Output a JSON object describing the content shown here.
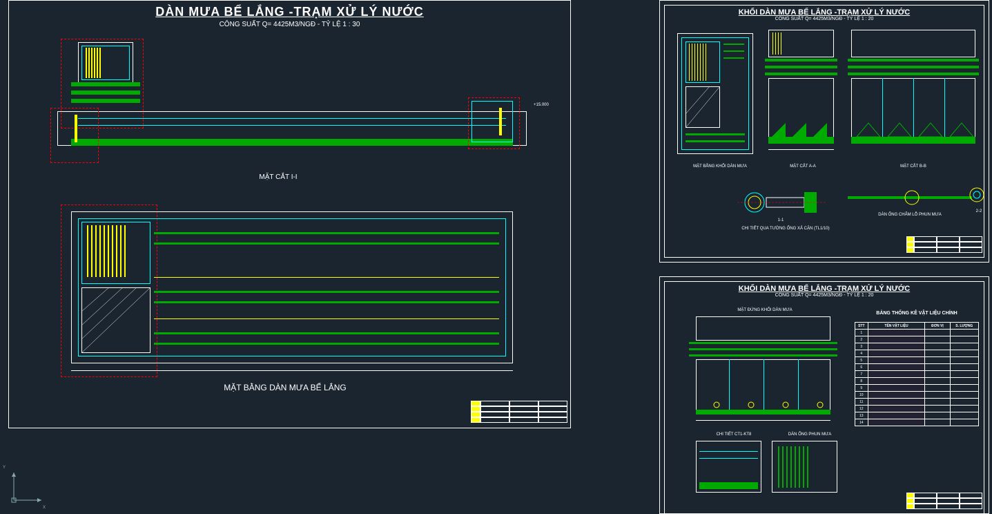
{
  "sheet1": {
    "title": "DÀN MƯA BỂ LẮNG -TRẠM XỬ LÝ NƯỚC",
    "subtitle": "CÔNG SUẤT Q= 4425M3/NGĐ - TỶ LỆ 1 : 30",
    "section_label": "MẶT CẮT I-I",
    "plan_label": "MẶT BẰNG DÀN MƯA BỂ LẮNG",
    "elevation_mark": "+15.000"
  },
  "sheet2": {
    "title": "KHỐI DÀN MƯA BỂ LẮNG -TRẠM XỬ LÝ NƯỚC",
    "subtitle": "CÔNG SUẤT Q= 4425M3/NGĐ - TỶ LỆ 1 : 20",
    "plan_label": "MẶT BẰNG KHỐI DÀN MƯA",
    "section_a": "MẶT CẮT A-A",
    "section_b": "MẶT CẮT B-B",
    "detail_pipe": "CHI TIẾT QUA TƯỜNG ỐNG XẢ CẶN (TL1/10)",
    "detail_11": "1-1",
    "detail_spray": "DÀN ỐNG CHẨM LỖ PHUN MƯA",
    "detail_22": "2-2"
  },
  "sheet3": {
    "title": "KHỐI DÀN MƯA BỂ LẮNG -TRẠM XỬ LÝ NƯỚC",
    "subtitle": "CÔNG SUẤT Q= 4425M3/NGĐ - TỶ LỆ 1 : 20",
    "elev_label": "MẶT ĐỨNG KHỐI DÀN MƯA",
    "detail_ct": "CHI TIẾT CT1-KT8",
    "detail_spray2": "DÀN ỐNG PHUN MƯA",
    "table_title": "BẢNG THỐNG KÊ VẬT LIỆU CHÍNH",
    "table_headers": {
      "c1": "STT",
      "c2": "TÊN VẬT LIỆU",
      "c3": "ĐƠN VỊ",
      "c4": "S. LƯỢNG"
    },
    "table_rows": [
      {
        "n": "1",
        "name": "",
        "unit": "",
        "qty": ""
      },
      {
        "n": "2",
        "name": "",
        "unit": "",
        "qty": ""
      },
      {
        "n": "3",
        "name": "",
        "unit": "",
        "qty": ""
      },
      {
        "n": "4",
        "name": "",
        "unit": "",
        "qty": ""
      },
      {
        "n": "5",
        "name": "",
        "unit": "",
        "qty": ""
      },
      {
        "n": "6",
        "name": "",
        "unit": "",
        "qty": ""
      },
      {
        "n": "7",
        "name": "",
        "unit": "",
        "qty": ""
      },
      {
        "n": "8",
        "name": "",
        "unit": "",
        "qty": ""
      },
      {
        "n": "9",
        "name": "",
        "unit": "",
        "qty": ""
      },
      {
        "n": "10",
        "name": "",
        "unit": "",
        "qty": ""
      },
      {
        "n": "11",
        "name": "",
        "unit": "",
        "qty": ""
      },
      {
        "n": "12",
        "name": "",
        "unit": "",
        "qty": ""
      },
      {
        "n": "13",
        "name": "",
        "unit": "",
        "qty": ""
      },
      {
        "n": "14",
        "name": "",
        "unit": "",
        "qty": ""
      }
    ]
  },
  "ucs": {
    "x": "X",
    "y": "Y"
  }
}
